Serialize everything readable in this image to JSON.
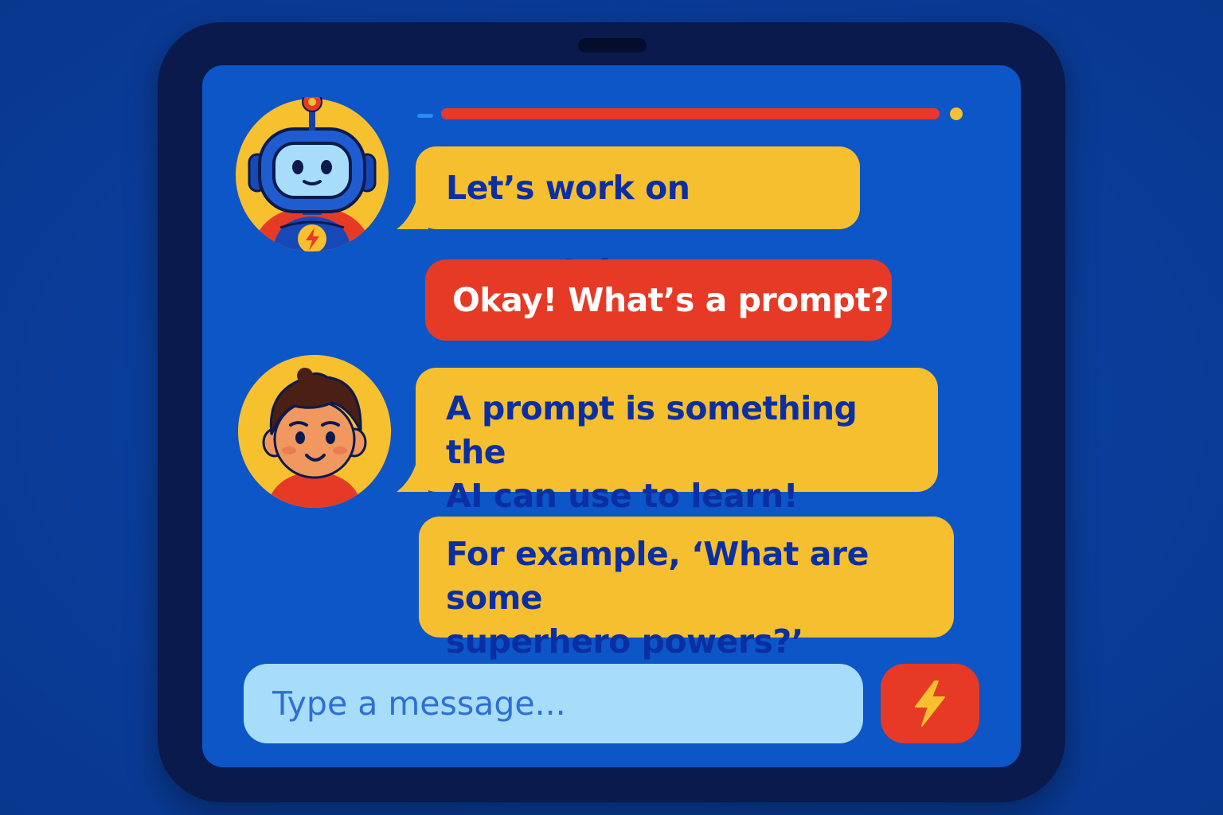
{
  "colors": {
    "background": "#0a3d9a",
    "tablet_frame": "#0a1a4d",
    "screen": "#0c56c7",
    "bot_bubble": "#f6bf2f",
    "bot_text": "#0b2fa3",
    "user_bubble": "#e63a26",
    "user_text": "#ffffff",
    "input_bg": "#a8dcfb",
    "send_button": "#e63a26",
    "progress_bar": "#e8382a",
    "progress_dot": "#f6c02e"
  },
  "chat": {
    "messages": [
      {
        "sender": "bot",
        "avatar": "robot-avatar-icon",
        "text": "Let’s work on prompts!"
      },
      {
        "sender": "user",
        "text": "Okay! What’s a prompt?"
      },
      {
        "sender": "bot",
        "avatar": "kid-avatar-icon",
        "lines": [
          "A prompt is something the",
          "AI can use to learn!"
        ]
      },
      {
        "sender": "bot",
        "lines": [
          "For example, ‘What are some",
          "superhero powers?’"
        ]
      }
    ]
  },
  "composer": {
    "placeholder": "Type a message...",
    "send_icon": "lightning-bolt-icon"
  }
}
